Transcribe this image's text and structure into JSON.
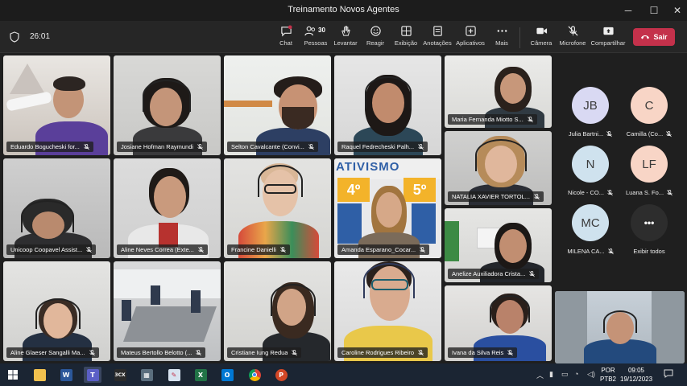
{
  "window": {
    "title": "Treinamento Novos Agentes",
    "minimize": "─",
    "maximize": "☐",
    "close": "✕"
  },
  "toolbar": {
    "timer": "26:01",
    "chat": "Chat",
    "people": "Pessoas",
    "people_count": "30",
    "raise": "Levantar",
    "react": "Reagir",
    "view": "Exibição",
    "notes": "Anotações",
    "apps": "Aplicativos",
    "more": "Mais",
    "camera": "Câmera",
    "mic": "Microfone",
    "share": "Compartilhar",
    "leave": "Sair"
  },
  "tiles": [
    {
      "name": "Eduardo Bogucheski for..."
    },
    {
      "name": "Josiane Hofman Raymundi"
    },
    {
      "name": "Selton Cavalcante (Convi..."
    },
    {
      "name": "Raquel Fedrecheski Palh..."
    },
    {
      "name": "Maria Fernanda Miotto S..."
    },
    {
      "name": "Unicoop Coopavel Assist..."
    },
    {
      "name": "Aline Neves Correa (Exte..."
    },
    {
      "name": "Francine Danielli"
    },
    {
      "name": "Amanda Esparano_Cocar..."
    },
    {
      "name": "NATALIA XAVIER TORTOL..."
    },
    {
      "name": "Anelize Auxiliadora Crista..."
    },
    {
      "name": "Aline Glaeser Sangalli Ma..."
    },
    {
      "name": "Mateus Bertollo Belotto (..."
    },
    {
      "name": "Cristiane Iung Redua"
    },
    {
      "name": "Caroline Rodrigues Ribeiro"
    },
    {
      "name": "Ivana da Silva Reis"
    }
  ],
  "poster": {
    "word": "ATIVISMO",
    "n1": "4º",
    "n2": "5º"
  },
  "avatars": [
    {
      "initials": "JB",
      "name": "Julia Bartni...",
      "color": "#d9d9f3"
    },
    {
      "initials": "C",
      "name": "Camilla (Co...",
      "color": "#f8d5c6"
    },
    {
      "initials": "N",
      "name": "Nicole - CO...",
      "color": "#cfe2ee"
    },
    {
      "initials": "LF",
      "name": "Luana S. Fo...",
      "color": "#f8d5c6"
    },
    {
      "initials": "MC",
      "name": "MILENA CA...",
      "color": "#cfe2ee"
    },
    {
      "initials": "•••",
      "name": "Exibir todos",
      "color": "#2d2d2d"
    }
  ],
  "taskbar": {
    "lang1": "POR",
    "lang2": "PTB2",
    "time": "09:05",
    "date": "19/12/2023",
    "apps": [
      "explorer-icon",
      "word-icon",
      "teams-icon",
      "3cx-icon",
      "calculator-icon",
      "paint-icon",
      "excel-icon",
      "outlook-icon",
      "chrome-icon",
      "powerpoint-icon"
    ]
  },
  "colors": {
    "leave": "#c4314b",
    "active_border": "#6264a7",
    "taskbar": "#1b2533"
  }
}
